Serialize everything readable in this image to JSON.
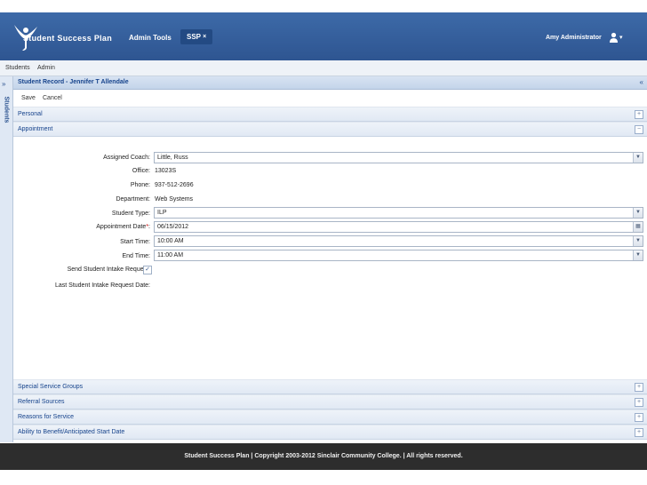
{
  "header": {
    "app_title": "Student Success Plan",
    "nav": [
      "Admin Tools",
      "SSP"
    ],
    "ssp_close": "×",
    "user_name": "Amy Administrator"
  },
  "menubar": {
    "items": [
      "Students",
      "Admin"
    ]
  },
  "rail": {
    "label": "Students",
    "expand": "»"
  },
  "record": {
    "title": "Student Record - Jennifer T Allendale",
    "collapse": "«",
    "toolbar": {
      "save": "Save",
      "cancel": "Cancel"
    }
  },
  "sections": {
    "personal": "Personal",
    "appointment": "Appointment",
    "special": "Special Service Groups",
    "referral": "Referral Sources",
    "reasons": "Reasons for Service",
    "ability": "Ability to Benefit/Anticipated Start Date",
    "expand": "+",
    "collapse": "−"
  },
  "appointment": {
    "assigned_coach_label": "Assigned Coach:",
    "assigned_coach": "Little, Russ",
    "office_label": "Office:",
    "office": "13023S",
    "phone_label": "Phone:",
    "phone": "937-512-2696",
    "department_label": "Department:",
    "department": "Web Systems",
    "student_type_label": "Student Type:",
    "student_type": "ILP",
    "appointment_date_label": "Appointment Date",
    "req_mark": "*",
    "appointment_date": "06/15/2012",
    "start_time_label": "Start Time:",
    "start_time": "10:00 AM",
    "end_time_label": "End Time:",
    "end_time": "11:00 AM",
    "send_intake_label": "Send Student Intake Request:",
    "send_intake_checked": "✓",
    "last_intake_label": "Last Student Intake Request Date:"
  },
  "footer": {
    "text": "Student Success Plan | Copyright 2003-2012 Sinclair Community College. | All rights reserved."
  },
  "colors": {
    "header": "#2e5591",
    "footer": "#2d2d2d",
    "panel_header": "#c4d5ea"
  },
  "icons": {
    "logo": "figure-logo-icon",
    "user": "user-icon",
    "calendar": "calendar-icon",
    "dropdown": "dropdown-arrow-icon"
  }
}
